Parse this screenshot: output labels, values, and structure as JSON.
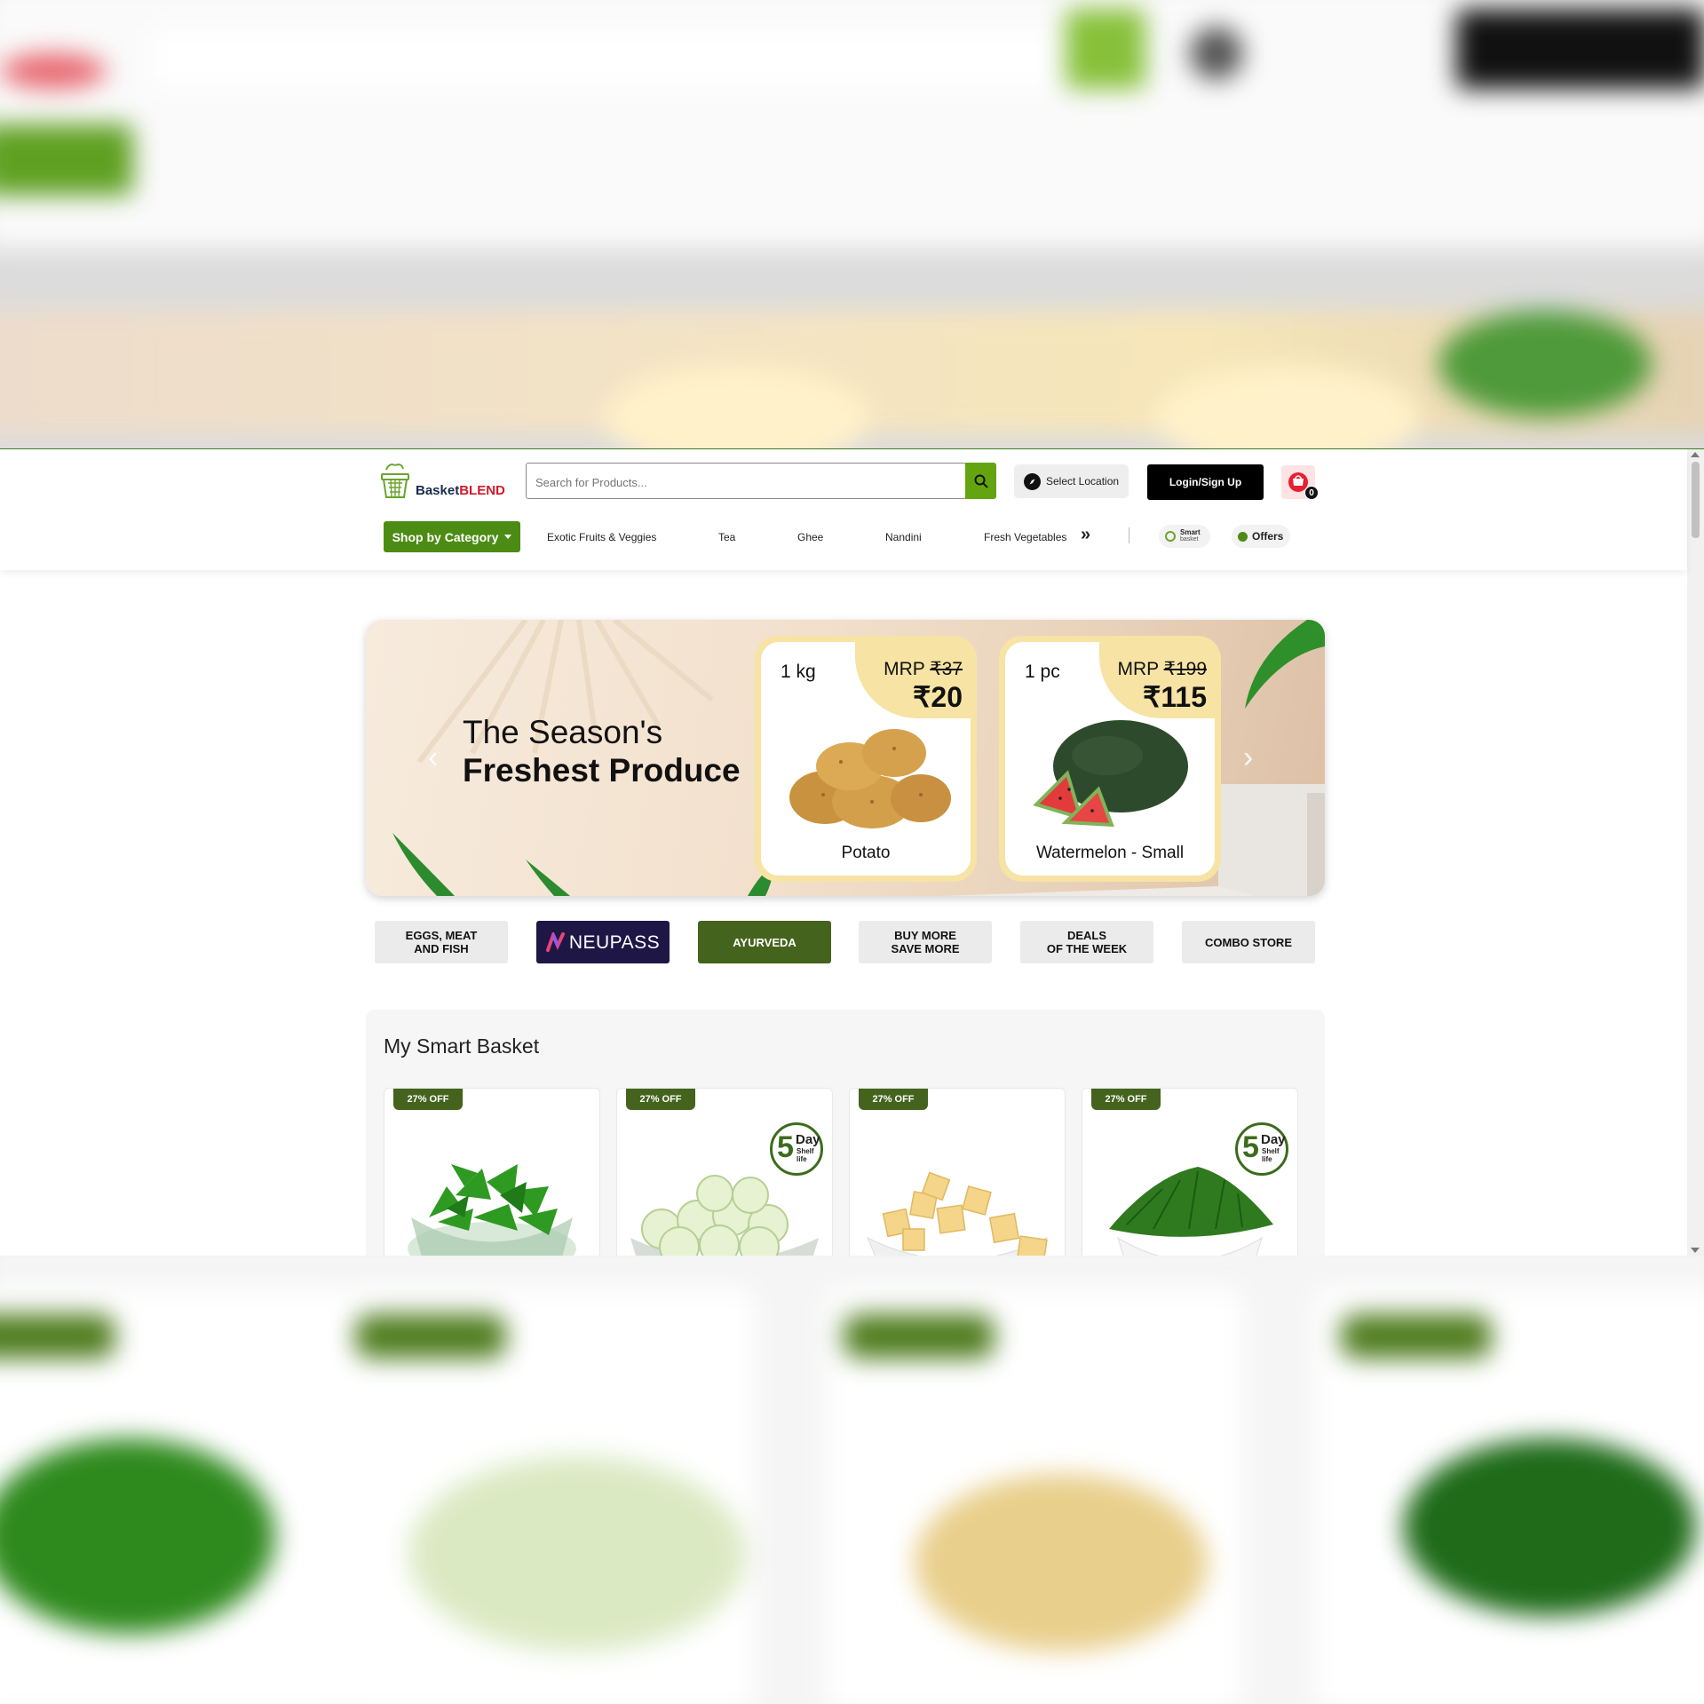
{
  "header": {
    "logo": {
      "name_part1": "Basket",
      "name_part2": "BLEND"
    },
    "search": {
      "placeholder": "Search for Products..."
    },
    "location_label": "Select Location",
    "login_label": "Login/Sign Up",
    "cart_count": "0"
  },
  "nav": {
    "category_button": "Shop by Category",
    "links": [
      "Exotic Fruits & Veggies",
      "Tea",
      "Ghee",
      "Nandini",
      "Fresh Vegetables"
    ],
    "more": "»",
    "smart_basket": {
      "title": "Smart",
      "subtitle": "basket"
    },
    "offers_label": "Offers"
  },
  "hero": {
    "heading_line1": "The Season's",
    "heading_line2": "Freshest Produce",
    "prev_arrow": "‹",
    "next_arrow": "›",
    "products": [
      {
        "qty": "1 kg",
        "mrp_label": "MRP",
        "mrp": "₹37",
        "price": "₹20",
        "name": "Potato"
      },
      {
        "qty": "1 pc",
        "mrp_label": "MRP",
        "mrp": "₹199",
        "price": "₹115",
        "name": "Watermelon - Small"
      }
    ]
  },
  "tiles": {
    "eggs": {
      "line1": "EGGS, MEAT",
      "line2": "AND FISH"
    },
    "neupass": "NEUPASS",
    "ayurveda": "AYURVEDA",
    "buy_more": {
      "line1": "BUY MORE",
      "line2": "SAVE MORE"
    },
    "deals": {
      "line1": "DEALS",
      "line2": "OF THE WEEK"
    },
    "combo": "COMBO STORE"
  },
  "smart_basket": {
    "title": "My Smart Basket",
    "items": [
      {
        "badge": "27% OFF",
        "image": "capsicum-bowl"
      },
      {
        "badge": "27% OFF",
        "image": "cucumber-bowl",
        "shelf": {
          "num": "5",
          "day": "Day",
          "sub1": "Shelf",
          "sub2": "life"
        }
      },
      {
        "badge": "27% OFF",
        "image": "paneer-bowl"
      },
      {
        "badge": "27% OFF",
        "image": "spinach-bowl",
        "shelf": {
          "num": "5",
          "day": "Day",
          "sub1": "Shelf",
          "sub2": "life"
        }
      }
    ]
  },
  "colors": {
    "brand_green": "#4c8b14",
    "search_green": "#64a50f",
    "dark_green": "#44631d",
    "brand_red": "#d4192c",
    "neupass_bg": "#1e1746"
  }
}
